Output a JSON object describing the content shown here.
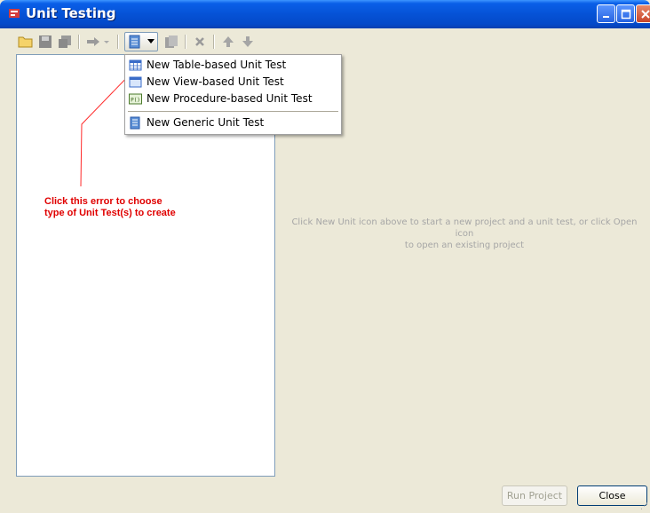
{
  "window": {
    "title": "Unit Testing",
    "app_icon": "unit-testing-app-icon",
    "controls": [
      "minimize-icon",
      "maximize-icon",
      "close-icon"
    ]
  },
  "toolbar": {
    "buttons": [
      {
        "name": "open-project",
        "icon": "folder-open-icon",
        "enabled": true
      },
      {
        "name": "save",
        "icon": "save-icon",
        "enabled": false
      },
      {
        "name": "save-as",
        "icon": "save-as-icon",
        "enabled": false
      },
      {
        "name": "run",
        "icon": "run-icon",
        "enabled": false
      },
      {
        "name": "new-unit",
        "icon": "new-unit-test-icon",
        "enabled": true,
        "active": true
      },
      {
        "name": "copy",
        "icon": "copy-test-icon",
        "enabled": false
      },
      {
        "name": "delete",
        "icon": "delete-icon",
        "enabled": false
      },
      {
        "name": "move-up",
        "icon": "arrow-up-icon",
        "enabled": false
      },
      {
        "name": "move-down",
        "icon": "arrow-down-icon",
        "enabled": false
      }
    ]
  },
  "menu": {
    "items": [
      {
        "label": "New Table-based Unit Test",
        "icon": "table-icon"
      },
      {
        "label": "New View-based Unit Test",
        "icon": "view-icon"
      },
      {
        "label": "New Procedure-based Unit Test",
        "icon": "procedure-icon"
      },
      {
        "label": "New Generic Unit Test",
        "icon": "generic-test-icon"
      }
    ]
  },
  "annotation": {
    "line1": "Click this error to choose",
    "line2": "type of Unit Test(s) to create",
    "color": "#e00000"
  },
  "main": {
    "hint_line1": "Click New Unit icon above to start a new project and a unit test, or click Open icon",
    "hint_line2": "to open an existing project"
  },
  "footer": {
    "run_project_label": "Run Project",
    "close_label": "Close"
  }
}
